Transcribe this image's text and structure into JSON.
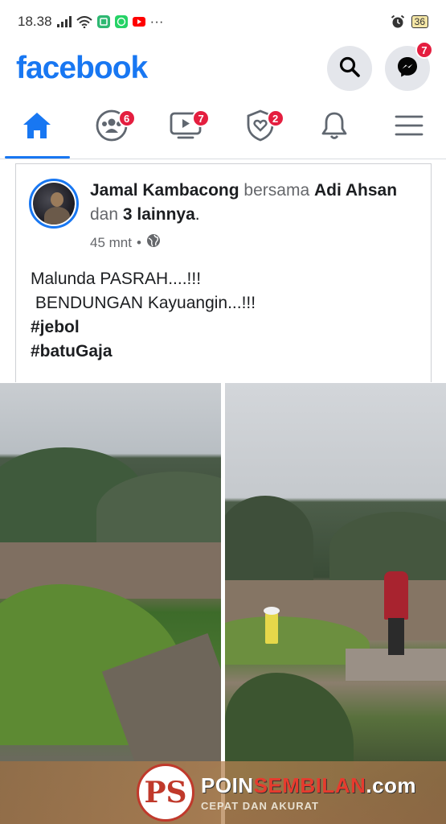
{
  "status_bar": {
    "time": "18.38",
    "icons": [
      "signal-icon",
      "wifi-icon",
      "sim-app-icon",
      "whatsapp-icon",
      "youtube-icon",
      "more-dots-icon"
    ],
    "more_dots": "···",
    "battery": "36"
  },
  "header": {
    "logo": "facebook",
    "search_label": "search",
    "messenger_badge": "7"
  },
  "nav": {
    "tabs": [
      {
        "name": "home",
        "icon": "home-icon",
        "active": true,
        "badge": ""
      },
      {
        "name": "groups",
        "icon": "groups-icon",
        "active": false,
        "badge": "6"
      },
      {
        "name": "watch",
        "icon": "video-icon",
        "active": false,
        "badge": "7"
      },
      {
        "name": "dating",
        "icon": "shield-heart-icon",
        "active": false,
        "badge": "2"
      },
      {
        "name": "notifications",
        "icon": "bell-icon",
        "active": false,
        "badge": ""
      },
      {
        "name": "menu",
        "icon": "hamburger-icon",
        "active": false,
        "badge": ""
      }
    ]
  },
  "post": {
    "author": "Jamal Kambacong",
    "with_word": "bersama",
    "tagged": "Adi Ahsan",
    "and_word": "dan",
    "others": "3 lainnya",
    "period": ".",
    "time": "45 mnt",
    "separator": "•",
    "privacy_icon": "globe-icon",
    "lines": [
      "Malunda PASRAH....!!!",
      " BENDUNGAN Kayuangin...!!!"
    ],
    "hashtags": [
      "#jebol",
      "#batuGaja"
    ]
  },
  "watermark": {
    "logo_text": "PS",
    "name_main": "POIN",
    "name_accent": "SEMBILAN",
    "name_suffix": ".com",
    "tagline": "CEPAT DAN AKURAT"
  },
  "colors": {
    "brand": "#1877f2",
    "badge": "#e41e3f",
    "muted_text": "#65676b"
  }
}
